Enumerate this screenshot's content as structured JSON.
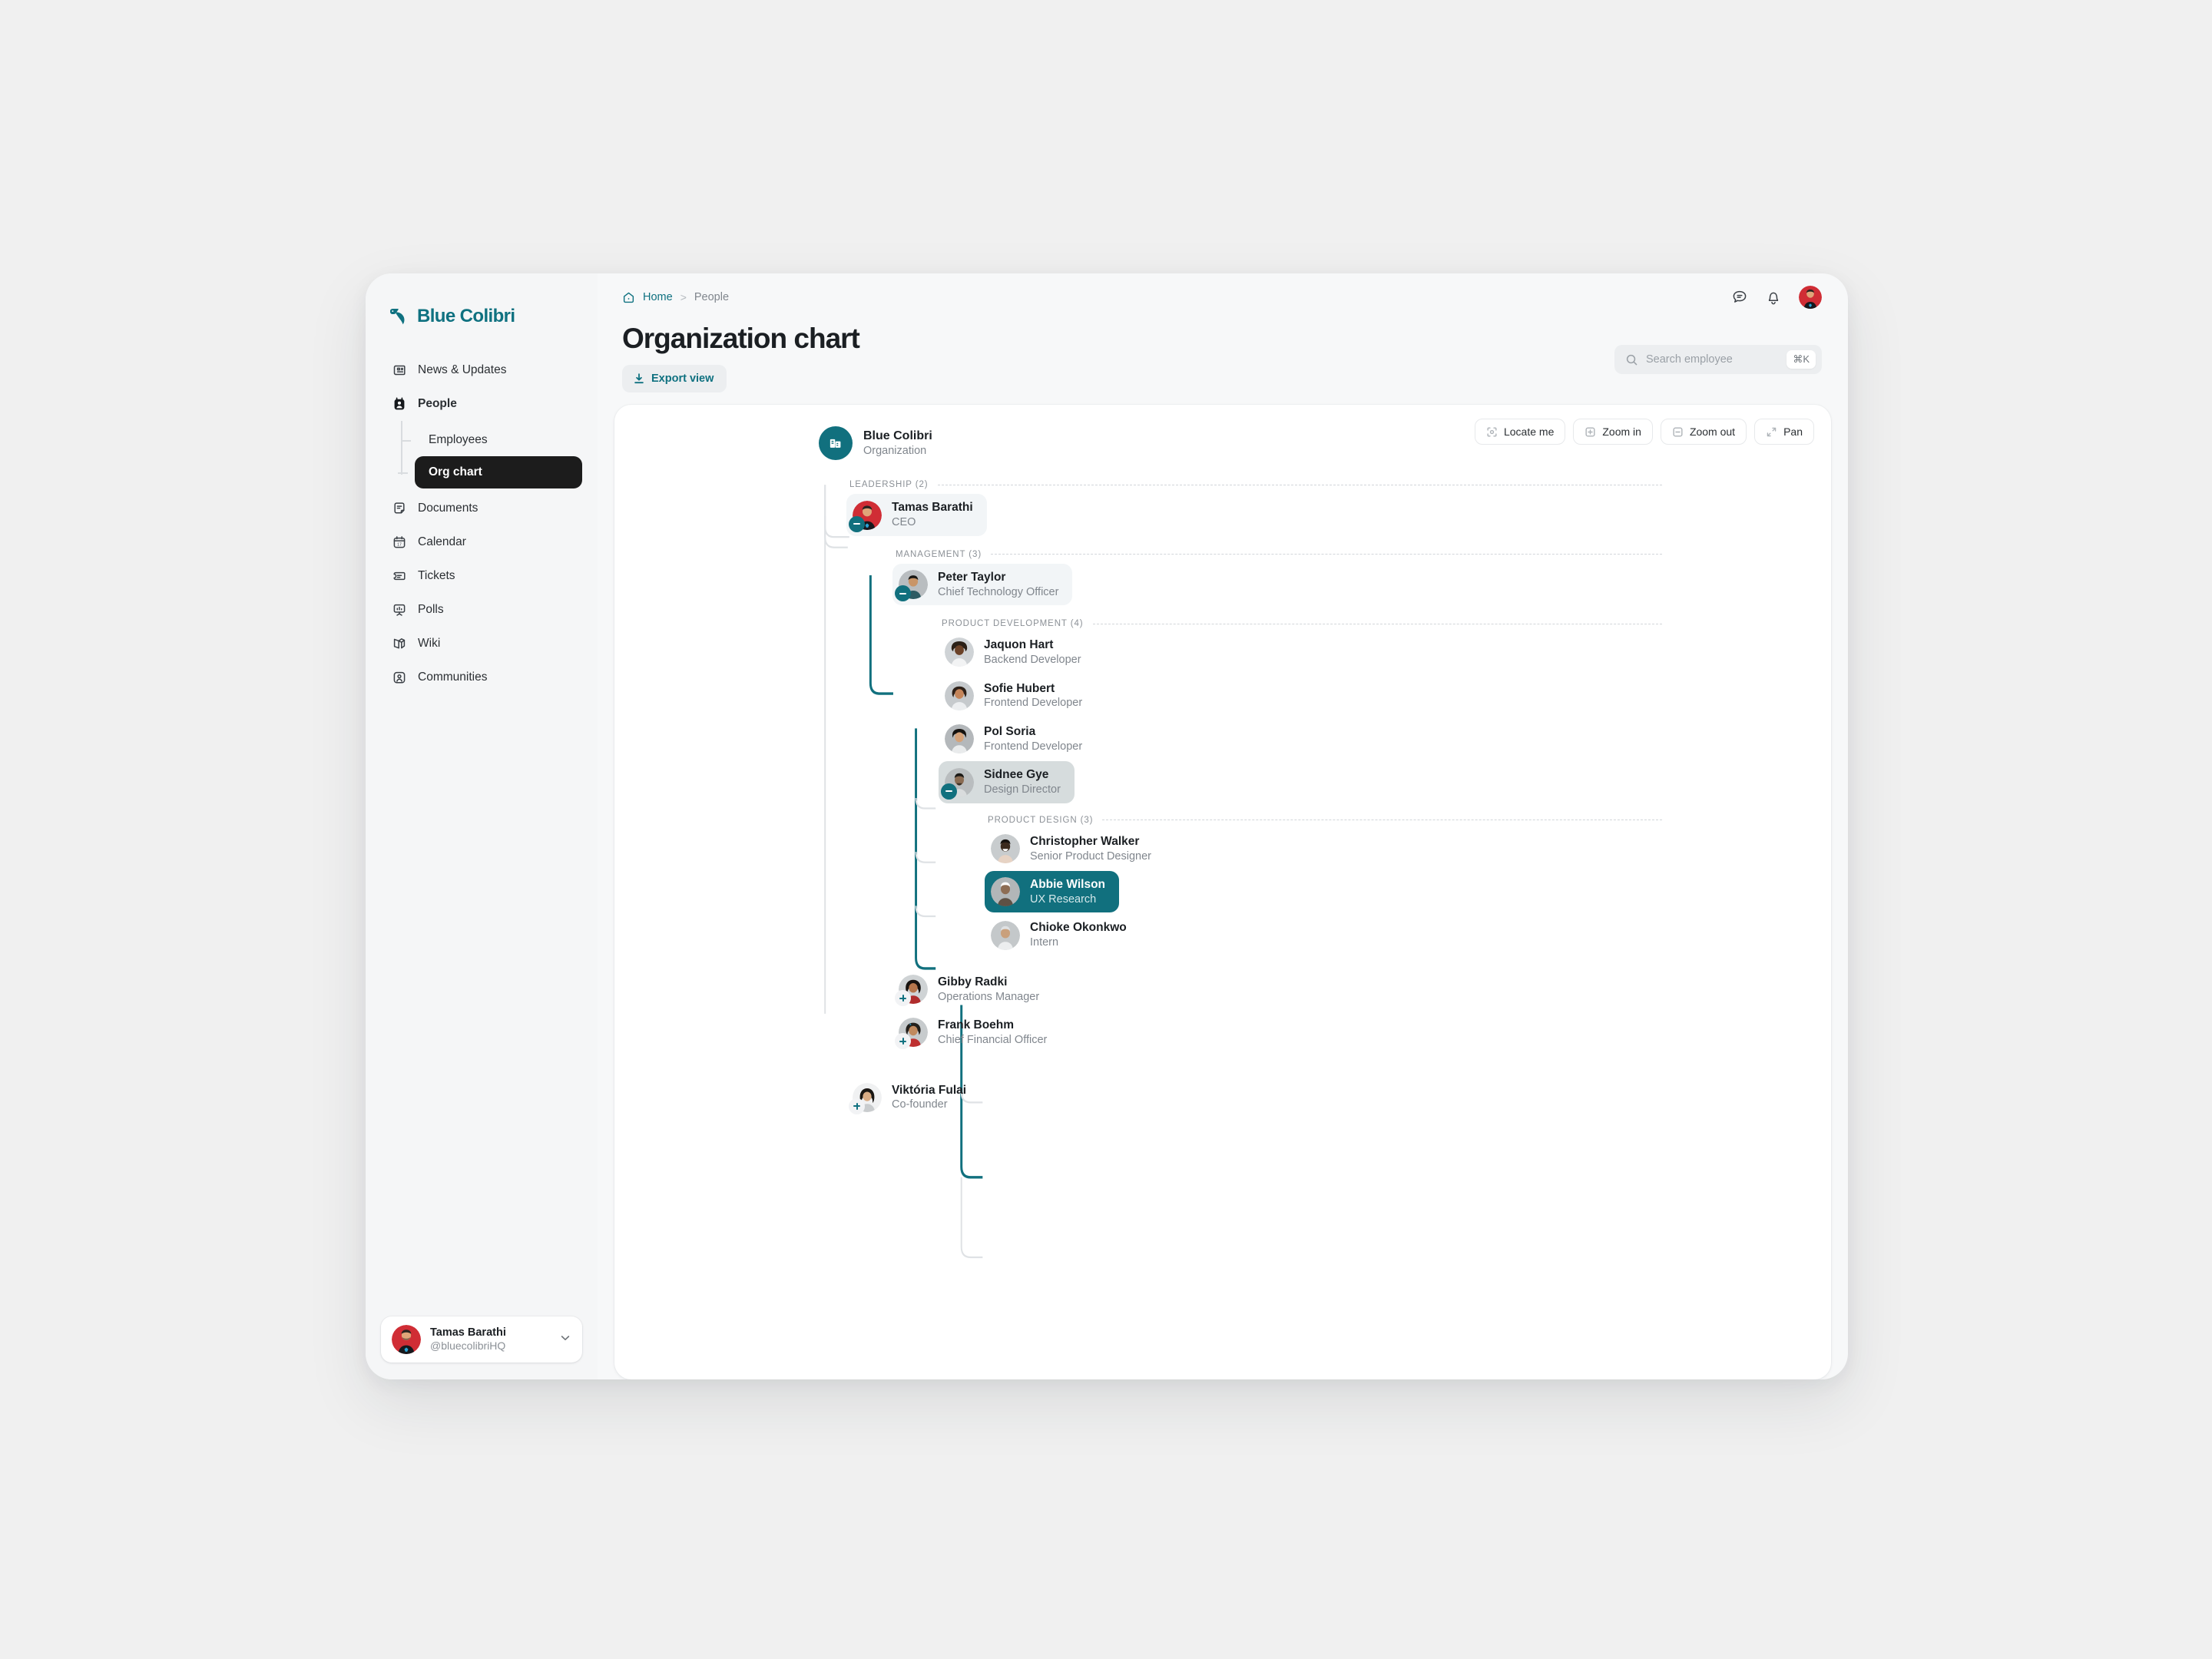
{
  "brand": {
    "name": "Blue Colibri",
    "logo_icon": "colibri-logo-icon",
    "accent": "#0f7180"
  },
  "sidebar": {
    "items": [
      {
        "label": "News & Updates",
        "icon": "news-icon",
        "active": false
      },
      {
        "label": "People",
        "icon": "people-icon",
        "active": true
      },
      {
        "label": "Documents",
        "icon": "documents-icon",
        "active": false
      },
      {
        "label": "Calendar",
        "icon": "calendar-icon",
        "active": false
      },
      {
        "label": "Tickets",
        "icon": "ticket-icon",
        "active": false
      },
      {
        "label": "Polls",
        "icon": "polls-icon",
        "active": false
      },
      {
        "label": "Wiki",
        "icon": "wiki-icon",
        "active": false
      },
      {
        "label": "Communities",
        "icon": "communities-icon",
        "active": false
      }
    ],
    "subitems": [
      {
        "label": "Employees",
        "selected": false
      },
      {
        "label": "Org chart",
        "selected": true
      }
    ],
    "user": {
      "name": "Tamas Barathi",
      "handle": "@bluecolibriHQ",
      "chevron_icon": "chevron-down-icon"
    }
  },
  "topbar": {
    "breadcrumb": {
      "home_icon": "home-icon",
      "home": "Home",
      "separator": ">",
      "current": "People"
    },
    "icons": [
      {
        "name": "messages-icon"
      },
      {
        "name": "notifications-bell-icon"
      }
    ],
    "avatar": "user-avatar"
  },
  "header": {
    "title": "Organization chart",
    "export_label": "Export view",
    "export_icon": "download-icon"
  },
  "search": {
    "placeholder": "Search employee",
    "value": "",
    "icon": "search-icon",
    "shortcut": "⌘K"
  },
  "chart_toolbar": [
    {
      "label": "Locate me",
      "icon": "locate-icon"
    },
    {
      "label": "Zoom in",
      "icon": "plus-square-icon"
    },
    {
      "label": "Zoom out",
      "icon": "minus-square-icon"
    },
    {
      "label": "Pan",
      "icon": "pan-arrows-icon"
    }
  ],
  "org": {
    "root": {
      "name": "Blue Colibri",
      "subtitle": "Organization",
      "icon": "building-icon"
    },
    "groups": {
      "leadership": "LEADERSHIP (2)",
      "management": "MANAGEMENT (3)",
      "product_development": "PRODUCT DEVELOPMENT (4)",
      "product_design": "PRODUCT DESIGN (3)"
    },
    "people": {
      "tamas": {
        "name": "Tamas Barathi",
        "role": "CEO",
        "badge": "minus"
      },
      "peter": {
        "name": "Peter Taylor",
        "role": "Chief Technology Officer",
        "badge": "minus"
      },
      "jaquon": {
        "name": "Jaquon Hart",
        "role": "Backend Developer",
        "badge": "none"
      },
      "sofie": {
        "name": "Sofie Hubert",
        "role": "Frontend Developer",
        "badge": "none"
      },
      "pol": {
        "name": "Pol Soria",
        "role": "Frontend Developer",
        "badge": "none"
      },
      "sidnee": {
        "name": "Sidnee Gye",
        "role": "Design Director",
        "badge": "minus"
      },
      "christopher": {
        "name": "Christopher Walker",
        "role": "Senior Product Designer",
        "badge": "none"
      },
      "abbie": {
        "name": "Abbie Wilson",
        "role": "UX Research",
        "badge": "none"
      },
      "chioke": {
        "name": "Chioke Okonkwo",
        "role": "Intern",
        "badge": "none"
      },
      "gibby": {
        "name": "Gibby Radki",
        "role": "Operations Manager",
        "badge": "plus"
      },
      "frank": {
        "name": "Frank Boehm",
        "role": "Chief Financial Officer",
        "badge": "plus"
      },
      "viktoria": {
        "name": "Viktória Fulai",
        "role": "Co-founder",
        "badge": "plus"
      }
    },
    "highlighted_person": "Abbie Wilson",
    "colors": {
      "teal": "#11707e",
      "line_active": "#11707e",
      "line_idle": "#dfe2e5"
    }
  }
}
